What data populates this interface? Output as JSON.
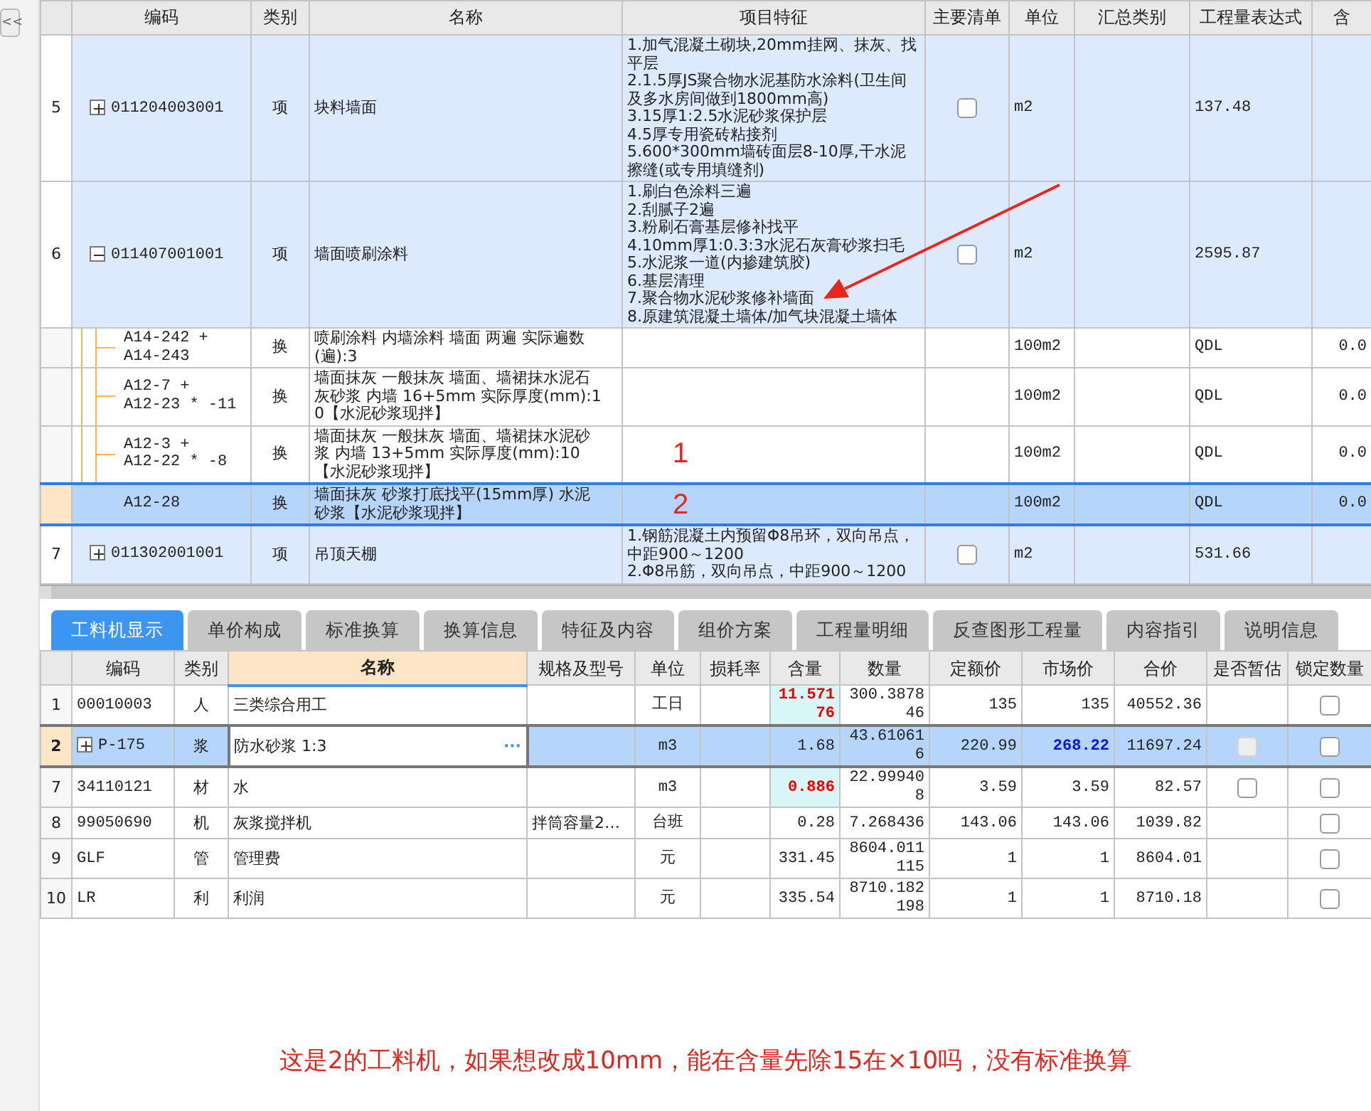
{
  "sidebar_toggle": {
    "label": "<<"
  },
  "top_table": {
    "columns": [
      "编码",
      "类别",
      "名称",
      "项目特征",
      "主要清单",
      "单位",
      "汇总类别",
      "工程量表达式",
      "含"
    ],
    "rows": [
      {
        "kind": "item",
        "number": "5",
        "code": "011204003001",
        "type": "项",
        "name": "块料墙面",
        "features": [
          "1.加气混凝土砌块,20mm挂网、抹灰、找平层",
          "2.1.5厚JS聚合物水泥基防水涂料(卫生间及多水房间做到1800mm高)",
          "3.15厚1:2.5水泥砂浆保护层",
          "4.5厚专用瓷砖粘接剂",
          "5.600*300mm墙砖面层8-10厚,干水泥擦缝(或专用填缝剂)"
        ],
        "main_list": false,
        "unit": "m2",
        "expression": "137.48",
        "expanded": false,
        "selected": false
      },
      {
        "kind": "item",
        "number": "6",
        "code": "011407001001",
        "type": "项",
        "name": "墙面喷刷涂料",
        "features": [
          "1.刷白色涂料三遍",
          "2.刮腻子2遍",
          "3.粉刷石膏基层修补找平",
          "4.10mm厚1:0.3:3水泥石灰膏砂浆扫毛",
          "5.水泥浆一道(内掺建筑胶)",
          "6.基层清理",
          "7.聚合物水泥砂浆修补墙面",
          "8.原建筑混凝土墙体/加气块混凝土墙体"
        ],
        "main_list": false,
        "unit": "m2",
        "expression": "2595.87",
        "expanded": true,
        "selected": false,
        "children": [
          {
            "kind": "sub",
            "code": "A14-242 +\nA14-243",
            "type": "换",
            "name": "喷刷涂料 内墙涂料 墙面 两遍  实际遍数(遍):3",
            "unit": "100m2",
            "expression": "QDL",
            "content": "0.0",
            "selected": false
          },
          {
            "kind": "sub",
            "code": "A12-7 +\nA12-23 * -11",
            "type": "换",
            "name": "墙面抹灰 一般抹灰 墙面、墙裙抹水泥石灰砂浆 内墙 16+5mm  实际厚度(mm):10【水泥砂浆现拌】",
            "unit": "100m2",
            "expression": "QDL",
            "content": "0.0",
            "selected": false
          },
          {
            "kind": "sub",
            "code": "A12-3 +\nA12-22 * -8",
            "type": "换",
            "name": "墙面抹灰 一般抹灰 墙面、墙裙抹水泥砂浆 内墙 13+5mm  实际厚度(mm):10【水泥砂浆现拌】",
            "annotation": "1",
            "unit": "100m2",
            "expression": "QDL",
            "content": "0.0",
            "selected": false
          },
          {
            "kind": "sub",
            "code": "A12-28",
            "type": "换",
            "name": "墙面抹灰 砂浆打底找平(15mm厚) 水泥砂浆【水泥砂浆现拌】",
            "annotation": "2",
            "unit": "100m2",
            "expression": "QDL",
            "content": "0.0",
            "selected": true
          }
        ]
      },
      {
        "kind": "item",
        "number": "7",
        "code": "011302001001",
        "type": "项",
        "name": "吊顶天棚",
        "features": [
          "1.钢筋混凝土内预留Φ8吊环，双向吊点，中距900～1200",
          "2.Φ8吊筋，双向吊点，中距900～1200"
        ],
        "main_list": false,
        "unit": "m2",
        "expression": "531.66",
        "expanded": false,
        "selected": false
      }
    ]
  },
  "tabs": [
    {
      "label": "工料机显示",
      "selected": true
    },
    {
      "label": "单价构成",
      "selected": false
    },
    {
      "label": "标准换算",
      "selected": false
    },
    {
      "label": "换算信息",
      "selected": false
    },
    {
      "label": "特征及内容",
      "selected": false
    },
    {
      "label": "组价方案",
      "selected": false
    },
    {
      "label": "工程量明细",
      "selected": false
    },
    {
      "label": "反查图形工程量",
      "selected": false
    },
    {
      "label": "内容指引",
      "selected": false
    },
    {
      "label": "说明信息",
      "selected": false
    }
  ],
  "detail_table": {
    "columns": [
      {
        "label": "编码",
        "selected": false
      },
      {
        "label": "类别",
        "selected": false
      },
      {
        "label": "名称",
        "selected": true
      },
      {
        "label": "规格及型号",
        "selected": false
      },
      {
        "label": "单位",
        "selected": false
      },
      {
        "label": "损耗率",
        "selected": false
      },
      {
        "label": "含量",
        "selected": false
      },
      {
        "label": "数量",
        "selected": false
      },
      {
        "label": "定额价",
        "selected": false
      },
      {
        "label": "市场价",
        "selected": false
      },
      {
        "label": "合价",
        "selected": false
      },
      {
        "label": "是否暂估",
        "selected": false
      },
      {
        "label": "锁定数量",
        "selected": false
      }
    ],
    "rows": [
      {
        "number": "1",
        "code": "00010003",
        "type": "人",
        "name": "三类综合用工",
        "unit": "工日",
        "content": "11.57176",
        "content_modified": true,
        "quantity": "300.387846",
        "quota_price": "135",
        "market_price": "135",
        "market_modified": false,
        "total": "40552.36",
        "locked": false,
        "selected": false
      },
      {
        "number": "2",
        "code": "P-175",
        "expanded": false,
        "type": "浆",
        "name": "防水砂浆 1:3",
        "editing": true,
        "edit_button": "···",
        "unit": "m3",
        "content": "1.68",
        "content_modified": false,
        "quantity": "43.610616",
        "quota_price": "220.99",
        "market_price": "268.22",
        "market_modified": true,
        "total": "11697.24",
        "provisional": {
          "checked": false,
          "disabled": true
        },
        "locked": false,
        "selected": true
      },
      {
        "number": "7",
        "code": "34110121",
        "type": "材",
        "name": "水",
        "unit": "m3",
        "content": "0.886",
        "content_modified": true,
        "quantity": "22.999408",
        "quota_price": "3.59",
        "market_price": "3.59",
        "market_modified": false,
        "total": "82.57",
        "provisional": {
          "checked": false,
          "disabled": false
        },
        "locked": false,
        "selected": false
      },
      {
        "number": "8",
        "code": "99050690",
        "type": "机",
        "name": "灰浆搅拌机",
        "spec": "拌筒容量2…",
        "unit": "台班",
        "content": "0.28",
        "content_modified": false,
        "quantity": "7.268436",
        "quota_price": "143.06",
        "market_price": "143.06",
        "market_modified": false,
        "total": "1039.82",
        "locked": false,
        "selected": false
      },
      {
        "number": "9",
        "code": "GLF",
        "type": "管",
        "name": "管理费",
        "unit": "元",
        "content": "331.45",
        "content_modified": false,
        "quantity": "8604.011115",
        "quota_price": "1",
        "market_price": "1",
        "market_modified": false,
        "total": "8604.01",
        "locked": false,
        "selected": false
      },
      {
        "number": "10",
        "code": "LR",
        "type": "利",
        "name": "利润",
        "unit": "元",
        "content": "335.54",
        "content_modified": false,
        "quantity": "8710.182198",
        "quota_price": "1",
        "market_price": "1",
        "market_modified": false,
        "total": "8710.18",
        "locked": false,
        "selected": false
      }
    ]
  },
  "note": "这是2的工料机，如果想改成10mm，能在含量先除15在×10吗，没有标准换算"
}
